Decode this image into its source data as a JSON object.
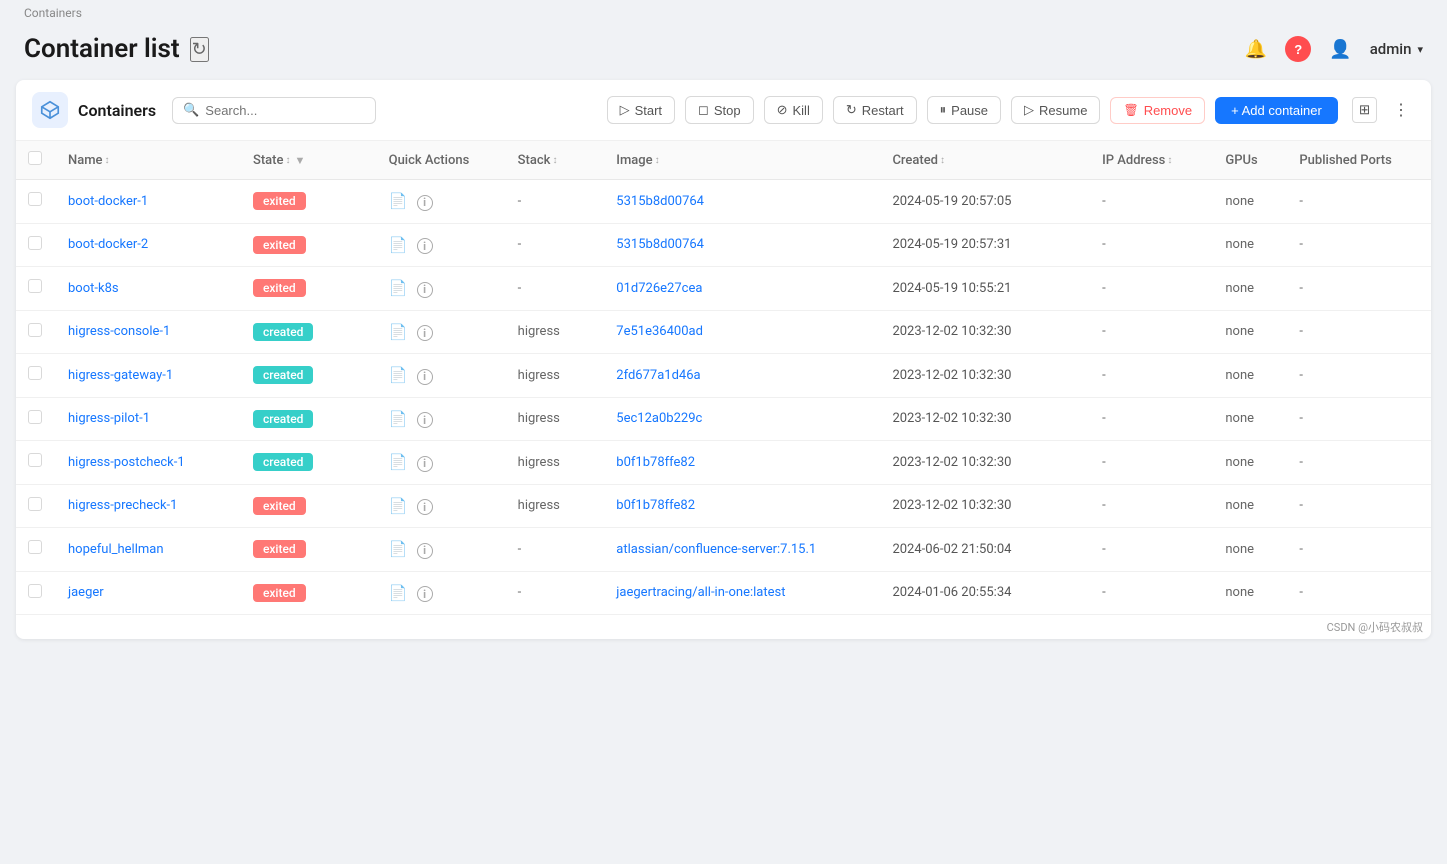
{
  "breadcrumb": "Containers",
  "page": {
    "title": "Container list",
    "refresh_icon": "↻"
  },
  "header": {
    "notification_label": "notifications",
    "help_label": "help",
    "user_label": "admin",
    "chevron": "▾"
  },
  "toolbar": {
    "logo_symbol": "⬡",
    "containers_label": "Containers",
    "search_placeholder": "Search...",
    "start_btn": "Start",
    "stop_btn": "Stop",
    "kill_btn": "Kill",
    "restart_btn": "Restart",
    "pause_btn": "Pause",
    "resume_btn": "Resume",
    "remove_btn": "Remove",
    "add_btn": "+ Add container",
    "more_icon": "⋮"
  },
  "table": {
    "columns": [
      "",
      "Name",
      "State",
      "Quick Actions",
      "Stack",
      "Image",
      "Created",
      "IP Address",
      "GPUs",
      "Published Ports"
    ],
    "rows": [
      {
        "name": "boot-docker-1",
        "state": "exited",
        "stack": "-",
        "image": "5315b8d00764",
        "created": "2024-05-19 20:57:05",
        "ip": "-",
        "gpus": "none",
        "ports": "-"
      },
      {
        "name": "boot-docker-2",
        "state": "exited",
        "stack": "-",
        "image": "5315b8d00764",
        "created": "2024-05-19 20:57:31",
        "ip": "-",
        "gpus": "none",
        "ports": "-"
      },
      {
        "name": "boot-k8s",
        "state": "exited",
        "stack": "-",
        "image": "01d726e27cea",
        "created": "2024-05-19 10:55:21",
        "ip": "-",
        "gpus": "none",
        "ports": "-"
      },
      {
        "name": "higress-console-1",
        "state": "created",
        "stack": "higress",
        "image": "7e51e36400ad",
        "created": "2023-12-02 10:32:30",
        "ip": "-",
        "gpus": "none",
        "ports": "-"
      },
      {
        "name": "higress-gateway-1",
        "state": "created",
        "stack": "higress",
        "image": "2fd677a1d46a",
        "created": "2023-12-02 10:32:30",
        "ip": "-",
        "gpus": "none",
        "ports": "-"
      },
      {
        "name": "higress-pilot-1",
        "state": "created",
        "stack": "higress",
        "image": "5ec12a0b229c",
        "created": "2023-12-02 10:32:30",
        "ip": "-",
        "gpus": "none",
        "ports": "-"
      },
      {
        "name": "higress-postcheck-1",
        "state": "created",
        "stack": "higress",
        "image": "b0f1b78ffe82",
        "created": "2023-12-02 10:32:30",
        "ip": "-",
        "gpus": "none",
        "ports": "-"
      },
      {
        "name": "higress-precheck-1",
        "state": "exited",
        "stack": "higress",
        "image": "b0f1b78ffe82",
        "created": "2023-12-02 10:32:30",
        "ip": "-",
        "gpus": "none",
        "ports": "-"
      },
      {
        "name": "hopeful_hellman",
        "state": "exited",
        "stack": "-",
        "image": "atlassian/confluence-server:7.15.1",
        "created": "2024-06-02 21:50:04",
        "ip": "-",
        "gpus": "none",
        "ports": "-"
      },
      {
        "name": "jaeger",
        "state": "exited",
        "stack": "-",
        "image": "jaegertracing/all-in-one:latest",
        "created": "2024-01-06 20:55:34",
        "ip": "-",
        "gpus": "none",
        "ports": "-"
      }
    ]
  },
  "watermark": "CSDN @小码农叔叔"
}
